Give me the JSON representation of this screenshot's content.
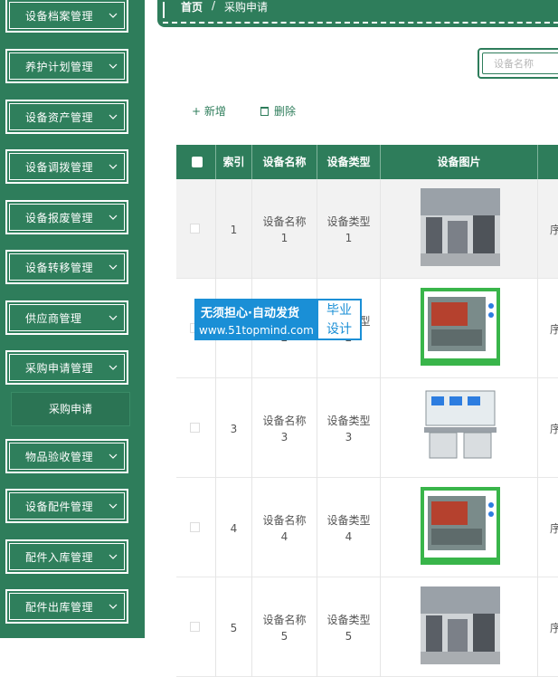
{
  "sidebar": {
    "items": [
      {
        "label": "设备档案管理"
      },
      {
        "label": "养护计划管理"
      },
      {
        "label": "设备资产管理"
      },
      {
        "label": "设备调拨管理"
      },
      {
        "label": "设备报废管理"
      },
      {
        "label": "设备转移管理"
      },
      {
        "label": "供应商管理"
      },
      {
        "label": "采购申请管理"
      },
      {
        "label": "物品验收管理"
      },
      {
        "label": "设备配件管理"
      },
      {
        "label": "配件入库管理"
      },
      {
        "label": "配件出库管理"
      }
    ],
    "submenu": {
      "label": "采购申请"
    }
  },
  "breadcrumb": {
    "home": "首页",
    "separator": "/",
    "current": "采购申请"
  },
  "search": {
    "placeholder": "设备名称"
  },
  "actions": {
    "add": "+ 新增",
    "delete": "删除"
  },
  "table": {
    "headers": [
      "索引",
      "设备名称",
      "设备类型",
      "设备图片"
    ],
    "rows": [
      {
        "index": "1",
        "name": "设备名称1",
        "type": "设备类型1",
        "image": "workshop-photo"
      },
      {
        "index": "2",
        "name": "设备名称2",
        "type": "设备类型2",
        "image": "machine-cabinet-photo"
      },
      {
        "index": "3",
        "name": "设备名称3",
        "type": "设备类型3",
        "image": "training-bench-photo"
      },
      {
        "index": "4",
        "name": "设备名称4",
        "type": "设备类型4",
        "image": "machine-cabinet-photo"
      },
      {
        "index": "5",
        "name": "设备名称5",
        "type": "设备类型5",
        "image": "workshop-photo"
      }
    ],
    "cut_text": "序"
  },
  "watermark": {
    "line1": "无须担心·自动发货",
    "line2": "www.51topmind.com",
    "box1": "毕业",
    "box2": "设计"
  },
  "colors": {
    "primary": "#2e7d5b",
    "watermark": "#1a8fd6"
  }
}
